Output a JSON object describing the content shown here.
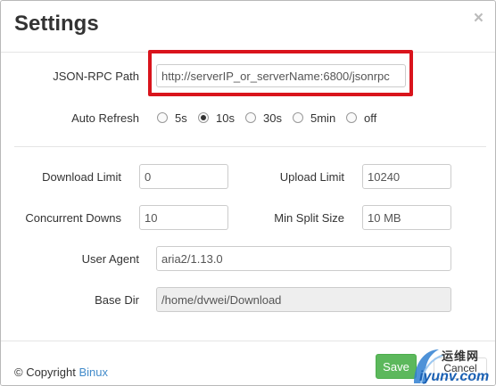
{
  "dialog": {
    "title": "Settings",
    "close_glyph": "×"
  },
  "rpc": {
    "label": "JSON-RPC Path",
    "value": "http://serverIP_or_serverName:6800/jsonrpc"
  },
  "auto_refresh": {
    "label": "Auto Refresh",
    "options": [
      "5s",
      "10s",
      "30s",
      "5min",
      "off"
    ],
    "selected": "10s"
  },
  "download_limit": {
    "label": "Download Limit",
    "value": "0"
  },
  "upload_limit": {
    "label": "Upload Limit",
    "value": "10240"
  },
  "concurrent": {
    "label": "Concurrent Downs",
    "value": "10"
  },
  "min_split": {
    "label": "Min Split Size",
    "value": "10 MB"
  },
  "user_agent": {
    "label": "User Agent",
    "value": "aria2/1.13.0"
  },
  "base_dir": {
    "label": "Base Dir",
    "value": "/home/dvwei/Download"
  },
  "footer": {
    "copyright_prefix": "© Copyright",
    "copyright_link": "Binux",
    "save_label": "Save",
    "cancel_label": "Cancel"
  },
  "watermark": {
    "text_cn": "运维网",
    "text_en": "iyunv.com"
  },
  "colors": {
    "highlight": "#d9141c",
    "save_button": "#5cb85c",
    "link": "#428bca"
  }
}
